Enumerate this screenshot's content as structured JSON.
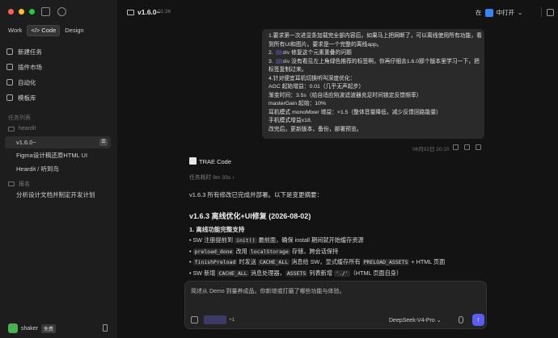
{
  "sidebar": {
    "mode_tabs": [
      "Work",
      "Code",
      "Design"
    ],
    "nav": [
      {
        "label": "新建任务",
        "icon": "new-task-icon"
      },
      {
        "label": "插件市场",
        "icon": "plugin-icon"
      },
      {
        "label": "自动化",
        "icon": "automation-icon"
      },
      {
        "label": "模板库",
        "icon": "template-icon"
      }
    ],
    "section_label": "任务列表",
    "folders": [
      {
        "name": "heardit",
        "tasks": [
          "v1.6.0~",
          "Figma设计稿还原HTML UI",
          "Heardit / 听到鸟"
        ]
      },
      {
        "name": "报名",
        "tasks": [
          "分析设计文档并制定开发计划"
        ]
      }
    ],
    "user": {
      "name": "shaker",
      "badge": "免费"
    }
  },
  "topbar": {
    "title": "v1.6.0~",
    "time": "01:36",
    "open_prefix": "在",
    "open_label": "中打开"
  },
  "user_message": {
    "lines": [
      "1.要求第一次进显条加载完全部内容后，如果马上把网断了，可以离线使用所有功能，看",
      "到所有UI和图片。要求是一个完整的离线app。",
      "2. [icon] div 修复这个元素重叠的问题",
      "3. [icon] div 没有看见左上角绿色推荐的标签啊，你再仔细去1.6.0那个版本里学习一下，把",
      "标签复制过来。",
      "4.针对便宜耳机切换听叫深度优化：",
      "AGC 起始增益：0.01（几乎无声起步）",
      "渐变时间：3.5s（给自适应陷波滤波器充足时间锁定反馈频率）",
      "masterGain 起始：10%",
      "耳机模式 monoMixer 增益：×1.5（整体音量降低，减少反馈回路能量）",
      "手机模式增益x18.",
      "改完后，更新版本，备份，部署预览。"
    ],
    "line2_rest": "修复这个元素重叠的问题",
    "line3_rest": "没有看见左上角绿色推荐的标签啊，你再仔细去1.6.0那个版本里学习一下，把",
    "chip_word": "div",
    "timestamp": "06月02日 20:10"
  },
  "assistant": {
    "name": "TRAE Code",
    "elapsed": "任务耗时 9m 33s ›",
    "summary": "v1.6.3 所有修改已完成并部署。以下是变更摘要：",
    "heading": "v1.6.3 离线优化+UI修复 (2026-08-02)",
    "subheading": "1. 离线功能完整支持",
    "bullets": [
      [
        {
          "t": "SW 注册提前到 "
        },
        {
          "c": "init()"
        },
        {
          "t": " 最前面，确保 install 期间就开始缓存资源"
        }
      ],
      [
        {
          "c": "preload_done"
        },
        {
          "t": " 改用 "
        },
        {
          "c": "localStorage"
        },
        {
          "t": " 存储，跨会话保持"
        }
      ],
      [
        {
          "c": "finishPreload"
        },
        {
          "t": " 时发送 "
        },
        {
          "c": "CACHE_ALL"
        },
        {
          "t": " 消息给 SW，显式缓存所有 "
        },
        {
          "c": "PRELOAD_ASSETS"
        },
        {
          "t": " + HTML 页面"
        }
      ],
      [
        {
          "t": "SW 新增 "
        },
        {
          "c": "CACHE_ALL"
        },
        {
          "t": " 消息处理器，"
        },
        {
          "c": "ASSETS"
        },
        {
          "t": " 列表新增 "
        },
        {
          "c": "'./'"
        },
        {
          "t": "（HTML 页面自身）"
        }
      ]
    ]
  },
  "composer": {
    "placeholder": "简述从 Demo 到量养成品。你新增或打磨了哪些功能与体验。",
    "ctx_more": "+1",
    "model": "DeepSeek-V4-Pro ⌄",
    "send_glyph": "↑"
  }
}
